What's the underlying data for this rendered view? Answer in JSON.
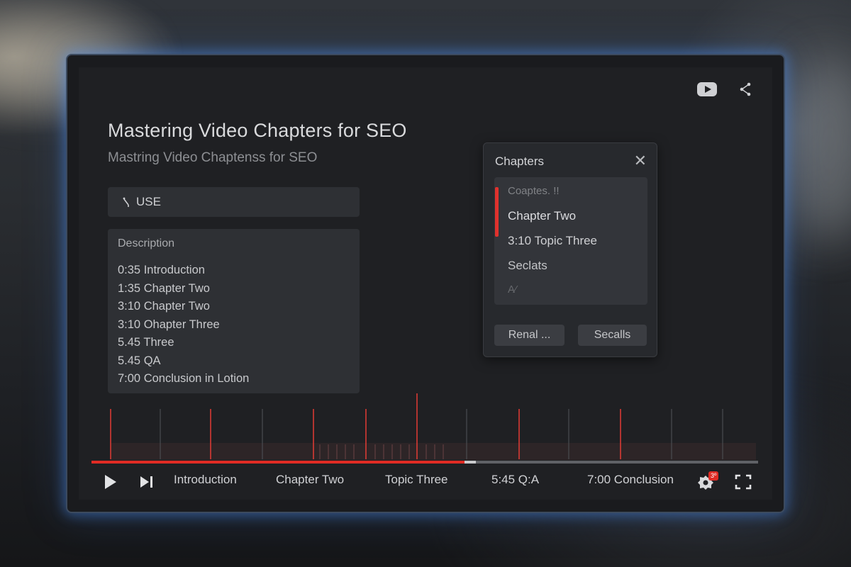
{
  "video": {
    "title": "Mastering Video Chapters for SEO",
    "subtitle": "Mastring Video Chaptenss for SEO"
  },
  "search": {
    "text": "USE",
    "icon": "search-icon"
  },
  "description": {
    "label": "Description",
    "lines": [
      "0:35 Introduction",
      "1:35 Chapter Two",
      "3:10 Chapter Two",
      "3:10 Ohapter Three",
      "5.45 Three",
      "5.45 QA",
      "7:00 Conclusion in Lotion"
    ]
  },
  "chapters_panel": {
    "title": "Chapters",
    "items": [
      "Coaptes. !!",
      "Chapter Two",
      "3:10 Topic Three",
      "Seclats",
      "A⁄"
    ],
    "buttons": [
      "Renal ...",
      "Secalls"
    ]
  },
  "player": {
    "progress": 0.56,
    "buffered": 0.577,
    "chapter_labels": [
      "Introduction",
      "Chapter Two",
      "Topic Three",
      "5:45 Q:A",
      "7:00 Conclusion"
    ],
    "settings_badge": "3º"
  },
  "colors": {
    "accent": "#e02b24",
    "glow": "#4f96ff"
  }
}
